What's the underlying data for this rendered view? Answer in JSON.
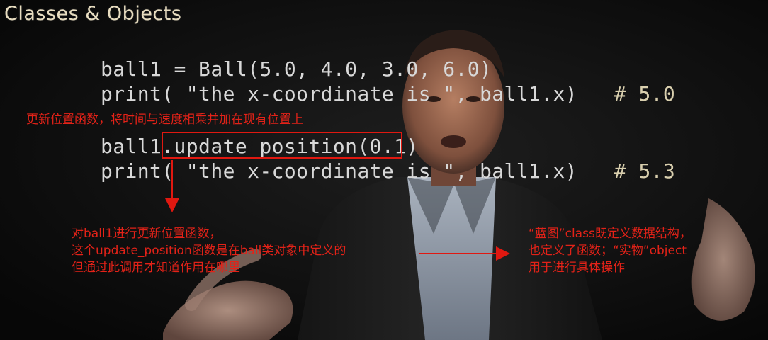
{
  "slide": {
    "title": "Classes & Objects",
    "code_lines": [
      {
        "code": "ball1 = Ball(5.0, 4.0, 3.0, 6.0)",
        "comment": ""
      },
      {
        "code": "print( \"the x-coordinate is \", ball1.x)   ",
        "comment": "# 5.0"
      },
      {
        "code": "ball1.update_position(0.1)",
        "comment": ""
      },
      {
        "code": "print( \"the x-coordinate is \", ball1.x)   ",
        "comment": "# 5.3"
      }
    ]
  },
  "annotations": {
    "top": "更新位置函数，将时间与速度相乘并加在现有位置上",
    "middle": [
      "对ball1进行更新位置函数，",
      "这个update_position函数是在ball类对象中定义的",
      "但通过此调用才知道作用在哪里"
    ],
    "right": [
      "“蓝图”class既定义数据结构，",
      "也定义了函数；“实物”object",
      "用于进行具体操作"
    ],
    "accent_color": "#e32218"
  }
}
